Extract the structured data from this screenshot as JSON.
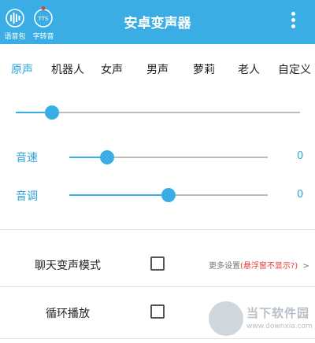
{
  "header": {
    "title": "安卓变声器",
    "voice_pack_label": "语音包",
    "tts_label": "字转音",
    "tts_icon_text": "TTS",
    "menu_icon": "kebab-menu-icon",
    "background_color": "#3aaee4"
  },
  "tabs": [
    "原声",
    "机器人",
    "女声",
    "男声",
    "萝莉",
    "老人",
    "自定义"
  ],
  "active_tab": "原声",
  "sliders": {
    "main": {
      "value_fraction": 0.12
    },
    "speed": {
      "label": "音速",
      "value": "0",
      "value_fraction": 0.19
    },
    "pitch": {
      "label": "音调",
      "value": "0",
      "value_fraction": 0.5
    }
  },
  "options": {
    "chat_mode": {
      "label": "聊天变声模式",
      "checked": false
    },
    "loop_play": {
      "label": "循环播放",
      "checked": false
    },
    "more_settings": {
      "prefix": "更多设置",
      "warning": "(悬浮窗不显示?)",
      "chevron": ">"
    }
  },
  "watermark": {
    "brand": "当下软件园",
    "url": "www.downxia.com"
  },
  "colors": {
    "accent": "#3aaee4",
    "warning": "#e53935"
  }
}
